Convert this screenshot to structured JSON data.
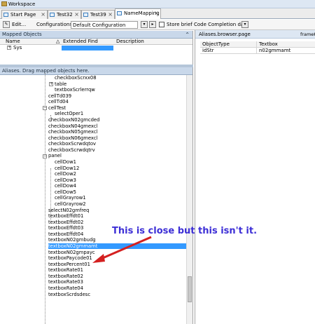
{
  "window": {
    "title": "Workspace"
  },
  "tabs": [
    {
      "label": "Start Page",
      "active": false
    },
    {
      "label": "Test32",
      "active": false
    },
    {
      "label": "Test39",
      "active": false
    },
    {
      "label": "NameMapping",
      "active": true
    }
  ],
  "toolbar": {
    "edit_label": "Edit...",
    "configurations_label": "Configurations",
    "configuration_value": "Default Configuration",
    "store_label": "Store brief Code Completion data"
  },
  "mapped_objects": {
    "header": "Mapped Objects",
    "columns": [
      "Name",
      "Extended Find",
      "Description"
    ],
    "rows": [
      {
        "name": "Sys"
      }
    ]
  },
  "aliases": {
    "header": "Aliases. Drag mapped objects here.",
    "nodes": [
      {
        "label": "checkboxScrxx08"
      },
      {
        "label": "table"
      },
      {
        "label": "textboxScrlerrqw"
      },
      {
        "label": "cellTd039"
      },
      {
        "label": "cellTd04"
      },
      {
        "label": "cellTest"
      },
      {
        "label": "selectOper1"
      },
      {
        "label": "checkboxN02gmcded"
      },
      {
        "label": "checkboxN04gmexcl"
      },
      {
        "label": "checkboxN05gmexcl"
      },
      {
        "label": "checkboxN06gmexcl"
      },
      {
        "label": "checkboxScrwdqtov"
      },
      {
        "label": "checkboxScrwdqtrv"
      },
      {
        "label": "panel"
      },
      {
        "label": "cellDow1"
      },
      {
        "label": "cellDow12"
      },
      {
        "label": "cellDow2"
      },
      {
        "label": "cellDow3"
      },
      {
        "label": "cellDow4"
      },
      {
        "label": "cellDow5"
      },
      {
        "label": "cellGrayrow1"
      },
      {
        "label": "cellGrayrow2"
      },
      {
        "label": "selectN02gmfreq"
      },
      {
        "label": "textboxEffdt01"
      },
      {
        "label": "textboxEffdt02"
      },
      {
        "label": "textboxEffdt03"
      },
      {
        "label": "textboxEffdt04"
      },
      {
        "label": "textboxN02gmbudg"
      },
      {
        "label": "textboxN02gmmamt"
      },
      {
        "label": "textboxN02gmpayc"
      },
      {
        "label": "textboxPaycode01"
      },
      {
        "label": "textboxPercent01"
      },
      {
        "label": "textboxRate01"
      },
      {
        "label": "textboxRate02"
      },
      {
        "label": "textboxRate03"
      },
      {
        "label": "textboxRate04"
      },
      {
        "label": "textboxScrdsdesc"
      }
    ]
  },
  "properties": {
    "path": "Aliases.browser.page",
    "path_suffix": "frameKi",
    "columns": [
      "ObjectType",
      "Textbox"
    ],
    "rows": [
      {
        "key": "idStr",
        "value": "n02gmmamt"
      }
    ]
  },
  "annotation": {
    "text": "This is close but this isn't it.",
    "color": "#3d2fd6",
    "arrow_color": "#d42020"
  },
  "colors": {
    "selection": "#3399ff",
    "panel_header": "#c9d8ea"
  }
}
